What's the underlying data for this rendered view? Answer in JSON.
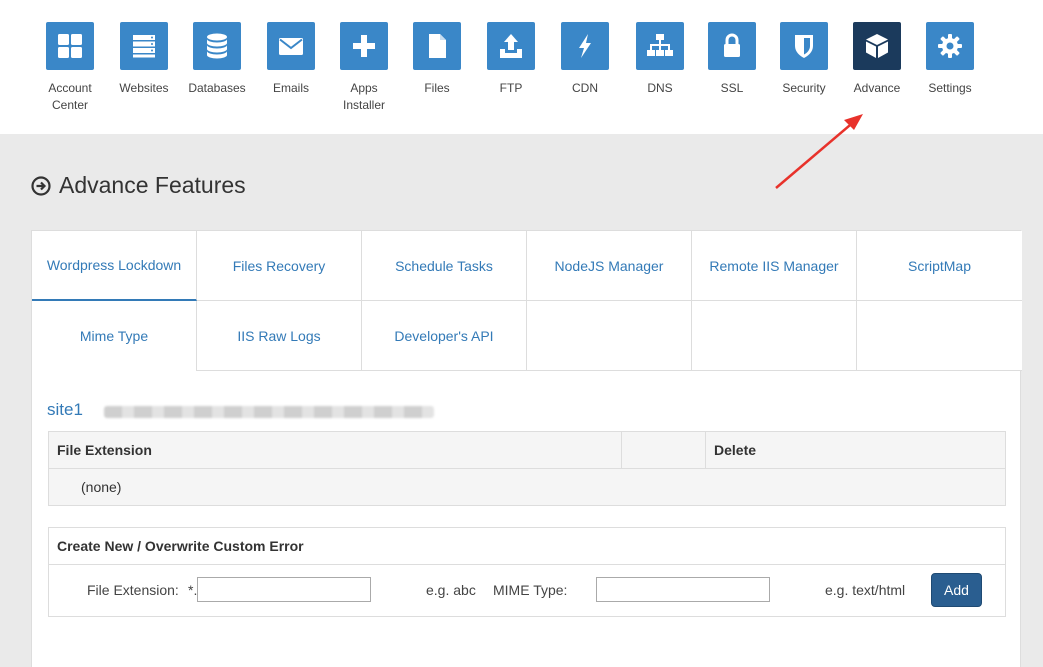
{
  "nav": {
    "items": [
      {
        "label": "Account Center",
        "icon": "account-center-icon"
      },
      {
        "label": "Websites",
        "icon": "websites-icon"
      },
      {
        "label": "Databases",
        "icon": "databases-icon"
      },
      {
        "label": "Emails",
        "icon": "emails-icon"
      },
      {
        "label": "Apps Installer",
        "icon": "apps-installer-icon"
      },
      {
        "label": "Files",
        "icon": "files-icon"
      },
      {
        "label": "FTP",
        "icon": "ftp-icon"
      },
      {
        "label": "CDN",
        "icon": "cdn-icon"
      },
      {
        "label": "DNS",
        "icon": "dns-icon"
      },
      {
        "label": "SSL",
        "icon": "ssl-icon"
      },
      {
        "label": "Security",
        "icon": "security-icon"
      },
      {
        "label": "Advance",
        "icon": "advance-icon",
        "active": true
      },
      {
        "label": "Settings",
        "icon": "settings-icon"
      }
    ]
  },
  "page": {
    "title": "Advance Features"
  },
  "tabs": [
    "Wordpress Lockdown",
    "Files Recovery",
    "Schedule Tasks",
    "NodeJS Manager",
    "Remote IIS Manager",
    "ScriptMap",
    "Mime Type",
    "IIS Raw Logs",
    "Developer's API"
  ],
  "site": {
    "name": "site1"
  },
  "table": {
    "headers": [
      "File Extension",
      "",
      "Delete"
    ],
    "empty_text": "(none)"
  },
  "create": {
    "title": "Create New / Overwrite Custom Error",
    "ext_label": "File Extension:",
    "ext_prefix": "*.",
    "ext_value": "",
    "ext_example": "e.g. abc",
    "mime_label": "MIME Type:",
    "mime_value": "",
    "mime_example": "e.g. text/html",
    "add_label": "Add"
  },
  "colors": {
    "accent": "#3a87c8",
    "active": "#1b3a5c",
    "link": "#337ab7",
    "annotation_arrow": "#e8322b"
  }
}
